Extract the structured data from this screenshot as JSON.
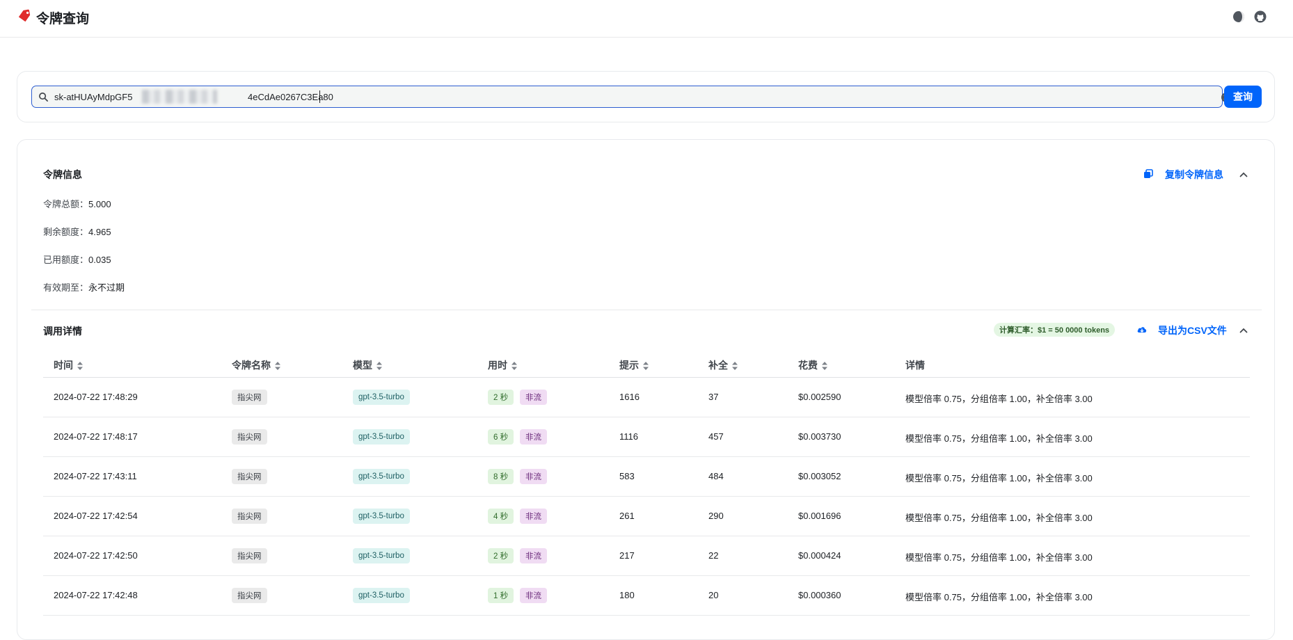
{
  "header": {
    "title": "令牌查询",
    "logo_icon": "tag-icon",
    "theme_icon": "moon-icon",
    "github_icon": "github-icon"
  },
  "search": {
    "value_prefix": "sk-atHUAyMdpGF5",
    "value_suffix": "4eCdAe0267C3Ea80",
    "button_label": "查询"
  },
  "token_info": {
    "title": "令牌信息",
    "copy_label": "复制令牌信息",
    "rows": [
      {
        "label": "令牌总额：",
        "value": "5.000"
      },
      {
        "label": "剩余额度：",
        "value": "4.965"
      },
      {
        "label": "已用额度：",
        "value": "0.035"
      },
      {
        "label": "有效期至：",
        "value": "永不过期"
      }
    ]
  },
  "usage": {
    "title": "调用详情",
    "rate_tag": "计算汇率：$1 = 50 0000 tokens",
    "export_label": "导出为CSV文件",
    "columns": {
      "time": "时间",
      "token_name": "令牌名称",
      "model": "模型",
      "duration": "用时",
      "prompt": "提示",
      "completion": "补全",
      "cost": "花费",
      "detail": "详情"
    },
    "rows": [
      {
        "time": "2024-07-22 17:48:29",
        "token_name": "指尖网",
        "model": "gpt-3.5-turbo",
        "duration": "2 秒",
        "stream": "非流",
        "prompt": "1616",
        "completion": "37",
        "cost": "$0.002590",
        "detail": "模型倍率 0.75，分组倍率 1.00，补全倍率 3.00"
      },
      {
        "time": "2024-07-22 17:48:17",
        "token_name": "指尖网",
        "model": "gpt-3.5-turbo",
        "duration": "6 秒",
        "stream": "非流",
        "prompt": "1116",
        "completion": "457",
        "cost": "$0.003730",
        "detail": "模型倍率 0.75，分组倍率 1.00，补全倍率 3.00"
      },
      {
        "time": "2024-07-22 17:43:11",
        "token_name": "指尖网",
        "model": "gpt-3.5-turbo",
        "duration": "8 秒",
        "stream": "非流",
        "prompt": "583",
        "completion": "484",
        "cost": "$0.003052",
        "detail": "模型倍率 0.75，分组倍率 1.00，补全倍率 3.00"
      },
      {
        "time": "2024-07-22 17:42:54",
        "token_name": "指尖网",
        "model": "gpt-3.5-turbo",
        "duration": "4 秒",
        "stream": "非流",
        "prompt": "261",
        "completion": "290",
        "cost": "$0.001696",
        "detail": "模型倍率 0.75，分组倍率 1.00，补全倍率 3.00"
      },
      {
        "time": "2024-07-22 17:42:50",
        "token_name": "指尖网",
        "model": "gpt-3.5-turbo",
        "duration": "2 秒",
        "stream": "非流",
        "prompt": "217",
        "completion": "22",
        "cost": "$0.000424",
        "detail": "模型倍率 0.75，分组倍率 1.00，补全倍率 3.00"
      },
      {
        "time": "2024-07-22 17:42:48",
        "token_name": "指尖网",
        "model": "gpt-3.5-turbo",
        "duration": "1 秒",
        "stream": "非流",
        "prompt": "180",
        "completion": "20",
        "cost": "$0.000360",
        "detail": "模型倍率 0.75，分组倍率 1.00，补全倍率 3.00"
      }
    ]
  },
  "colors": {
    "primary": "#0064fa",
    "tag_grey": "#eaeaea",
    "tag_cyan": "#dcf3f1",
    "tag_green": "#e1f4df",
    "tag_purple": "#f0dcf3"
  }
}
